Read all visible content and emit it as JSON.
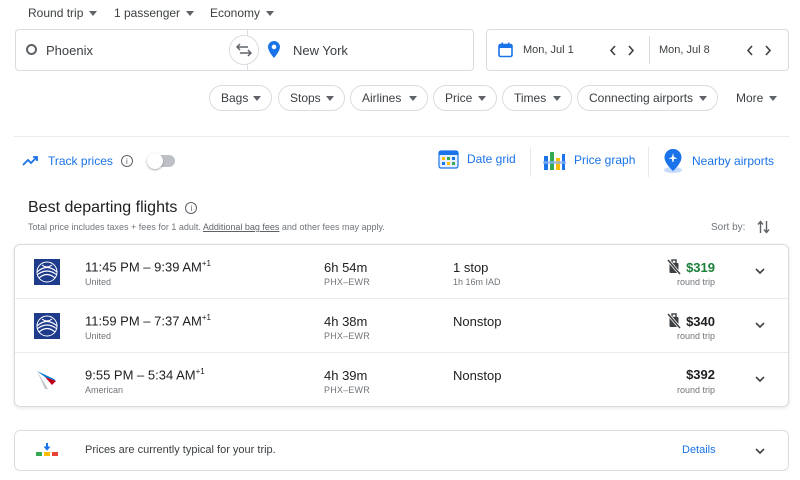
{
  "top": {
    "trip_type": "Round trip",
    "passengers": "1 passenger",
    "cabin": "Economy"
  },
  "search": {
    "origin": "Phoenix",
    "destination": "New York",
    "depart_date": "Mon, Jul 1",
    "return_date": "Mon, Jul 8"
  },
  "filters": [
    "Bags",
    "Stops",
    "Airlines",
    "Price",
    "Times",
    "Connecting airports",
    "More"
  ],
  "tools": {
    "track_prices": "Track prices",
    "date_grid": "Date grid",
    "price_graph": "Price graph",
    "nearby_airports": "Nearby airports"
  },
  "section": {
    "title": "Best departing flights",
    "note_prefix": "Total price includes taxes + fees for 1 adult. ",
    "note_link": "Additional bag fees",
    "note_suffix": " and other fees may apply.",
    "sort_label": "Sort by:"
  },
  "flights": [
    {
      "airline": "United",
      "logo": "united-logo-icon",
      "dep": "11:45 PM",
      "arr": "9:39 AM",
      "day_offset": "+1",
      "duration": "6h 54m",
      "route": "PHX–EWR",
      "stops": "1 stop",
      "layover": "1h 16m IAD",
      "price": "$319",
      "price_note": "round trip",
      "low_price": true,
      "no_bag": true
    },
    {
      "airline": "United",
      "logo": "united-logo-icon",
      "dep": "11:59 PM",
      "arr": "7:37 AM",
      "day_offset": "+1",
      "duration": "4h 38m",
      "route": "PHX–EWR",
      "stops": "Nonstop",
      "layover": "",
      "price": "$340",
      "price_note": "round trip",
      "low_price": false,
      "no_bag": true
    },
    {
      "airline": "American",
      "logo": "american-logo-icon",
      "dep": "9:55 PM",
      "arr": "5:34 AM",
      "day_offset": "+1",
      "duration": "4h 39m",
      "route": "PHX–EWR",
      "stops": "Nonstop",
      "layover": "",
      "price": "$392",
      "price_note": "round trip",
      "low_price": false,
      "no_bag": false
    }
  ],
  "insight": {
    "text": "Prices are currently typical for your trip.",
    "details": "Details"
  },
  "colors": {
    "accent": "#1a73e8",
    "low_price": "#188038",
    "border": "#dadce0"
  }
}
